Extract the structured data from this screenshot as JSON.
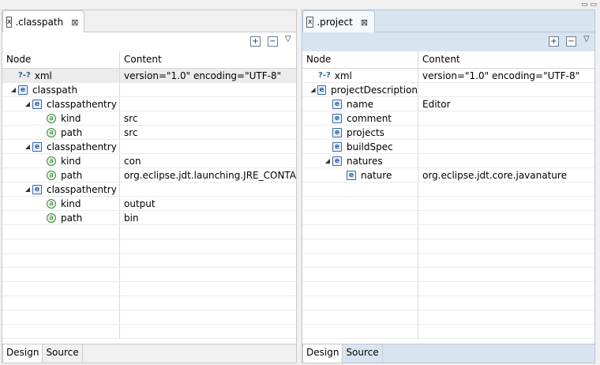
{
  "window_controls": "▭ ▭",
  "left": {
    "tab": {
      "icon": "x",
      "label": ".classpath",
      "close": "⊠"
    },
    "toolbar": {
      "expand": "+",
      "collapse": "−",
      "menu": "▽"
    },
    "columns": {
      "node": "Node",
      "content": "Content"
    },
    "rows": [
      {
        "node": "xml",
        "content": "version=\"1.0\" encoding=\"UTF-8\"",
        "icon": "pi"
      },
      {
        "node": "classpath",
        "content": "",
        "icon": "e"
      },
      {
        "node": "classpathentry",
        "content": "",
        "icon": "e"
      },
      {
        "node": "kind",
        "content": "src",
        "icon": "a"
      },
      {
        "node": "path",
        "content": "src",
        "icon": "a"
      },
      {
        "node": "classpathentry",
        "content": "",
        "icon": "e"
      },
      {
        "node": "kind",
        "content": "con",
        "icon": "a"
      },
      {
        "node": "path",
        "content": "org.eclipse.jdt.launching.JRE_CONTAI...",
        "icon": "a"
      },
      {
        "node": "classpathentry",
        "content": "",
        "icon": "e"
      },
      {
        "node": "kind",
        "content": "output",
        "icon": "a"
      },
      {
        "node": "path",
        "content": "bin",
        "icon": "a"
      }
    ],
    "bottom_tabs": {
      "design": "Design",
      "source": "Source"
    }
  },
  "right": {
    "tab": {
      "icon": "x",
      "label": ".project",
      "close": "⊠"
    },
    "toolbar": {
      "expand": "+",
      "collapse": "−",
      "menu": "▽"
    },
    "columns": {
      "node": "Node",
      "content": "Content"
    },
    "rows": [
      {
        "node": "xml",
        "content": "version=\"1.0\" encoding=\"UTF-8\"",
        "icon": "pi"
      },
      {
        "node": "projectDescription",
        "content": "",
        "icon": "e"
      },
      {
        "node": "name",
        "content": "Editor",
        "icon": "e"
      },
      {
        "node": "comment",
        "content": "",
        "icon": "e"
      },
      {
        "node": "projects",
        "content": "",
        "icon": "e"
      },
      {
        "node": "buildSpec",
        "content": "",
        "icon": "e"
      },
      {
        "node": "natures",
        "content": "",
        "icon": "e"
      },
      {
        "node": "nature",
        "content": "org.eclipse.jdt.core.javanature",
        "icon": "e"
      }
    ],
    "bottom_tabs": {
      "design": "Design",
      "source": "Source"
    }
  }
}
